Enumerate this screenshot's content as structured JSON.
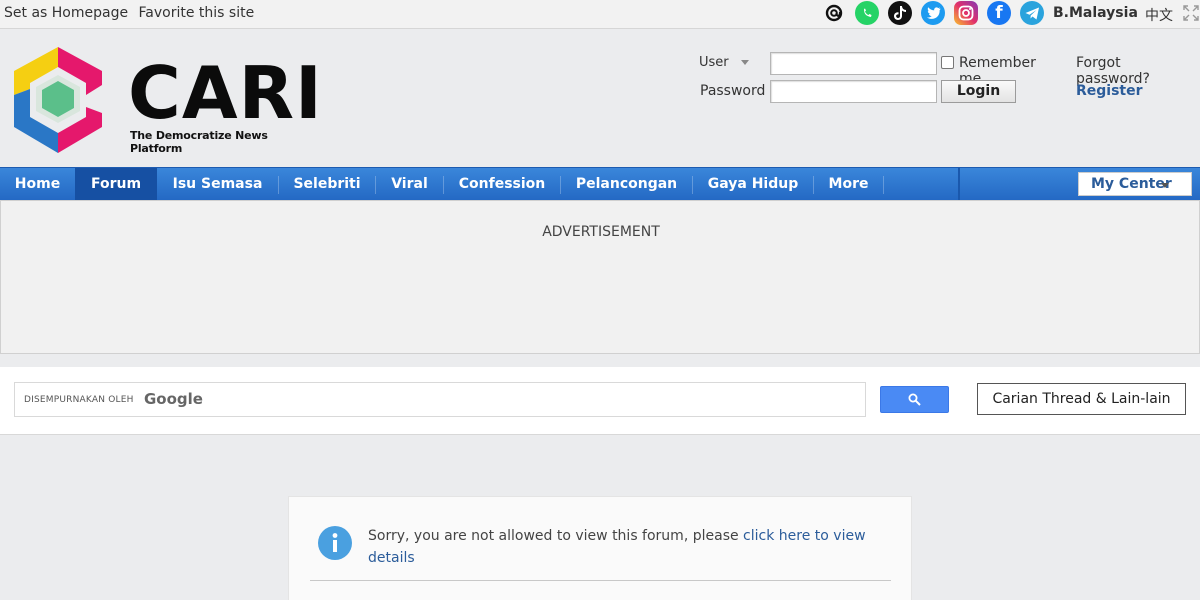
{
  "topbar": {
    "set_homepage": "Set as Homepage",
    "favorite": "Favorite this site",
    "social_icons": [
      "threads-icon",
      "whatsapp-icon",
      "tiktok-icon",
      "twitter-icon",
      "instagram-icon",
      "facebook-icon",
      "telegram-icon"
    ],
    "language": "B.Malaysia",
    "chinese": "中文"
  },
  "logo": {
    "wordmark": "CARI",
    "tagline": "The Democratize News Platform"
  },
  "login": {
    "user_label": "User",
    "password_label": "Password",
    "user_value": "",
    "password_value": "",
    "remember_label": "Remember me",
    "forgot_label": "Forgot password?",
    "login_button": "Login",
    "register_link": "Register"
  },
  "nav": {
    "items": [
      {
        "label": "Home"
      },
      {
        "label": "Forum"
      },
      {
        "label": "Isu Semasa"
      },
      {
        "label": "Selebriti"
      },
      {
        "label": "Viral"
      },
      {
        "label": "Confession"
      },
      {
        "label": "Pelancongan"
      },
      {
        "label": "Gaya Hidup"
      },
      {
        "label": "More"
      }
    ],
    "active": "Forum",
    "my_center": "My Center"
  },
  "ad": {
    "text": "ADVERTISEMENT"
  },
  "search": {
    "powered_by": "DISEMPURNAKAN OLEH",
    "google": "Google",
    "query": "",
    "carian_button": "Carian Thread & Lain-lain"
  },
  "notice": {
    "message": "Sorry, you are not allowed to view this forum, please ",
    "link": "click here to view details"
  },
  "colors": {
    "nav": "#2a73cc",
    "link": "#2b5c9a",
    "google_button": "#4a8af4"
  }
}
